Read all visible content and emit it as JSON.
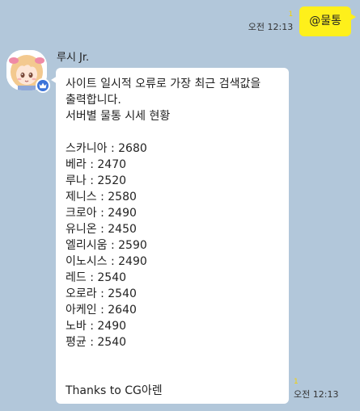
{
  "outgoing": {
    "text": "@물통",
    "time": "오전 12:13",
    "unread": "1",
    "bubble_color": "#fef01b"
  },
  "incoming": {
    "sender": "루시 Jr.",
    "time": "오전 12:13",
    "unread": "1",
    "intro_1": "사이트 일시적 오류로 가장 최근 검색값을 출력합니다.",
    "intro_2": "서버별 물통 시세 현황",
    "prices": [
      "스카니아 : 2680",
      "베라 : 2470",
      "루나 : 2520",
      "제니스 : 2580",
      "크로아 : 2490",
      "유니온 : 2450",
      "엘리시움 : 2590",
      "이노시스 : 2490",
      "레드 : 2540",
      "오로라 : 2540",
      "아케인 : 2640",
      "노바 : 2490",
      "평균 : 2540"
    ],
    "footer": "Thanks to CG아렌"
  },
  "colors": {
    "background": "#b2c7da",
    "unread_badge": "#f5d100",
    "badge_blue": "#3b73d9"
  },
  "icons": {
    "avatar": "anime-girl-avatar-icon",
    "badge": "crown-badge-icon"
  }
}
